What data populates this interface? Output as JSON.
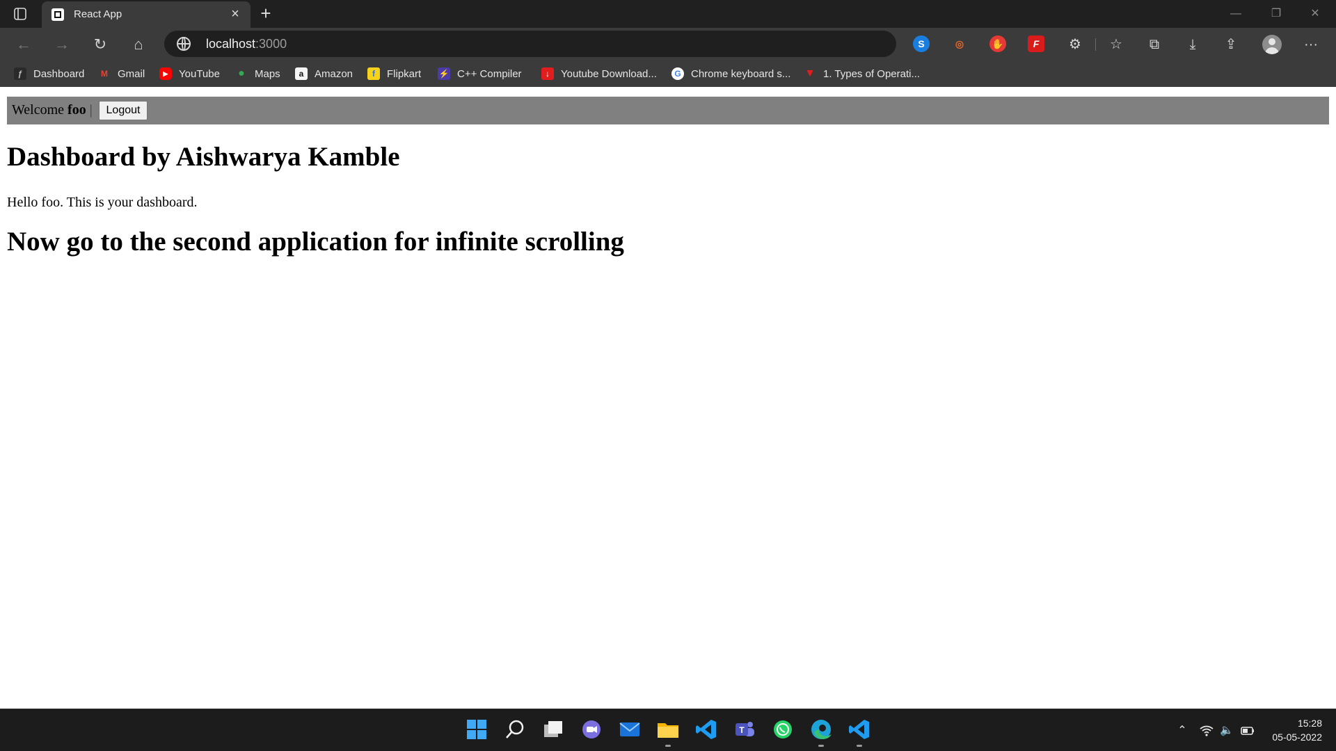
{
  "browser": {
    "tab": {
      "title": "React App"
    },
    "url": {
      "host": "localhost",
      "port": ":3000"
    },
    "bookmarks": [
      {
        "label": "Dashboard",
        "icon": "dashboard-icon"
      },
      {
        "label": "Gmail",
        "icon": "gmail-icon"
      },
      {
        "label": "YouTube",
        "icon": "youtube-icon"
      },
      {
        "label": "Maps",
        "icon": "maps-icon"
      },
      {
        "label": "Amazon",
        "icon": "amazon-icon"
      },
      {
        "label": "Flipkart",
        "icon": "flipkart-icon"
      },
      {
        "label": "C++ Compiler",
        "icon": "compiler-icon"
      },
      {
        "label": "Youtube Download...",
        "icon": "download-icon"
      },
      {
        "label": "Chrome keyboard s...",
        "icon": "google-icon"
      },
      {
        "label": "1. Types of Operati...",
        "icon": "bookmark-icon"
      }
    ]
  },
  "page": {
    "welcome_prefix": "Welcome",
    "username": "foo",
    "separator": "|",
    "logout_label": "Logout",
    "heading": "Dashboard by Aishwarya Kamble",
    "greeting": "Hello foo. This is your dashboard.",
    "subheading": "Now go to the second application for infinite scrolling"
  },
  "taskbar": {
    "time": "15:28",
    "date": "05-05-2022"
  },
  "colors": {
    "welcome_bar": "#808080",
    "tab_active": "#3b3b3b",
    "taskbar": "#1c1c1c"
  }
}
